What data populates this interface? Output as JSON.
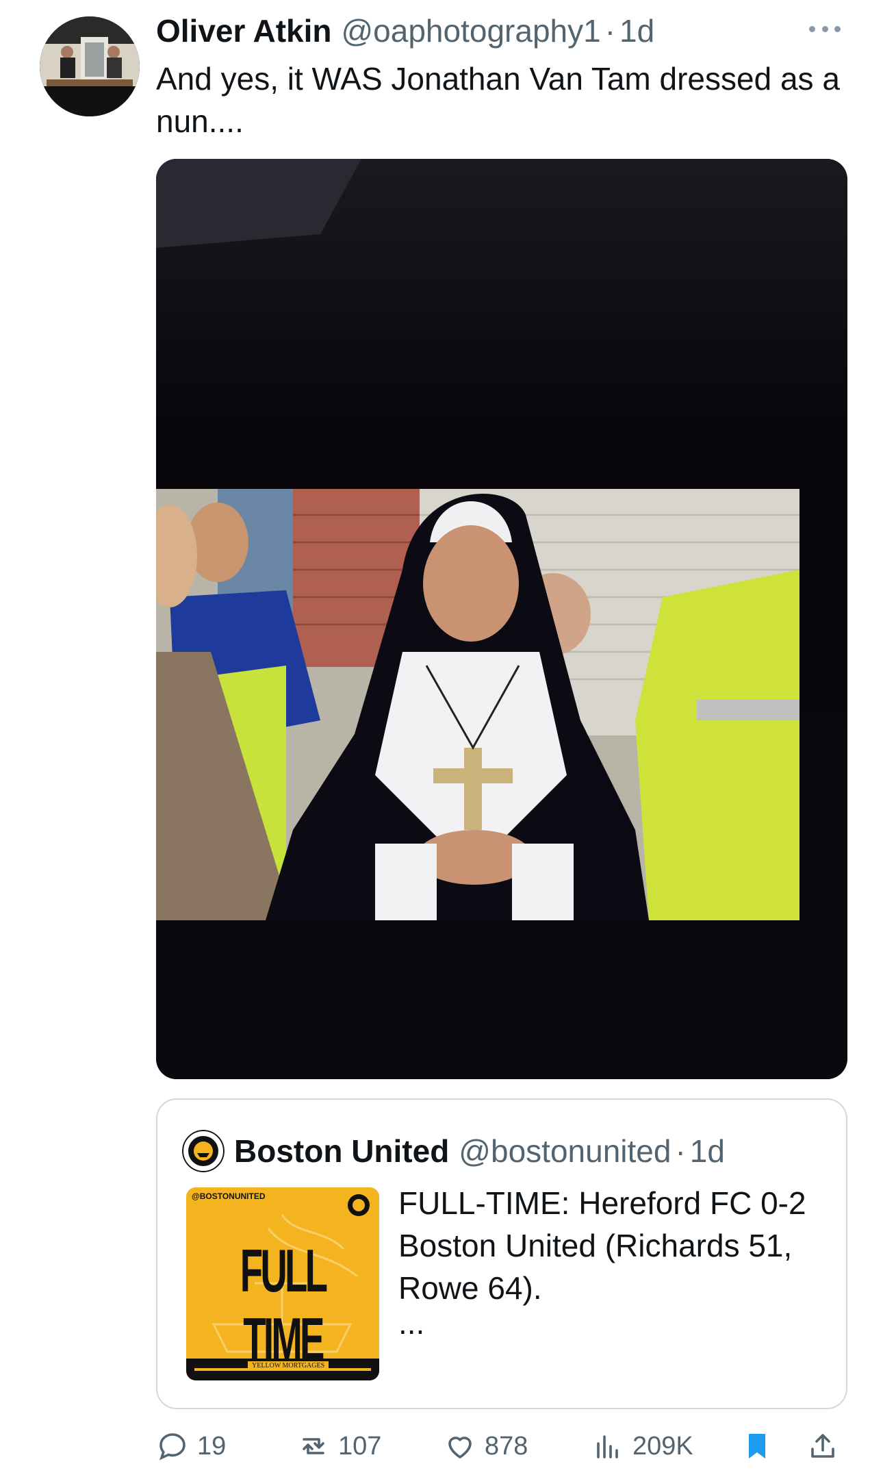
{
  "tweet": {
    "author_name": "Oliver Atkin",
    "author_handle": "@oaphotography1",
    "separator": "·",
    "time": "1d",
    "text": "And yes, it WAS Jonathan Van Tam dressed as a nun...."
  },
  "quoted_tweet": {
    "author_name": "Boston United",
    "author_handle": "@bostonunited",
    "separator": "·",
    "time": "1d",
    "text": "FULL-TIME: Hereford FC 0-2 Boston United (Richards 51, Rowe 64).",
    "ellipsis": "...",
    "thumbnail": {
      "tag": "@BOSTONUNITED",
      "headline": "FULL TIME",
      "sponsor": "YELLOW MORTGAGES",
      "background_color": "#f4b41f"
    }
  },
  "actions": {
    "replies": "19",
    "reposts": "107",
    "likes": "878",
    "views": "209K",
    "bookmark_color": "#1d9bf0"
  },
  "icons": [
    "reply-icon",
    "repost-icon",
    "like-icon",
    "views-icon",
    "bookmark-icon",
    "share-icon",
    "more-icon"
  ]
}
